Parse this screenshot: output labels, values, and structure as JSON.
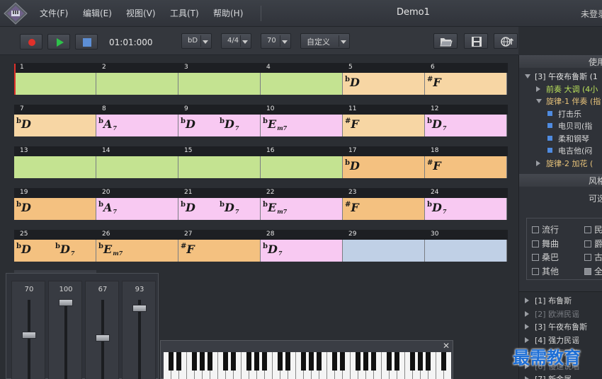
{
  "app": {
    "title": "Demo1",
    "login_text": "未登录",
    "menu": [
      "文件(F)",
      "编辑(E)",
      "视图(V)",
      "工具(T)",
      "帮助(H)"
    ]
  },
  "toolbar": {
    "time": "01:01:000",
    "key_label": "bD",
    "meter_label": "4/4",
    "tempo_label": "70",
    "style_label": "自定义"
  },
  "grid": {
    "rows": [
      [
        {
          "num": "1",
          "color": "#c4e391",
          "chords": []
        },
        {
          "num": "2",
          "color": "#c4e391",
          "chords": []
        },
        {
          "num": "3",
          "color": "#c4e391",
          "chords": []
        },
        {
          "num": "4",
          "color": "#c4e391",
          "chords": []
        },
        {
          "num": "5",
          "color": "#f7d6a4",
          "chords": [
            {
              "acc": "b",
              "root": "D",
              "suf": ""
            }
          ]
        },
        {
          "num": "6",
          "color": "#f7d6a4",
          "chords": [
            {
              "acc": "#",
              "root": "F",
              "suf": ""
            }
          ]
        }
      ],
      [
        {
          "num": "7",
          "color": "#f7d6a4",
          "chords": [
            {
              "acc": "b",
              "root": "D",
              "suf": ""
            }
          ]
        },
        {
          "num": "8",
          "color": "#f8c9f2",
          "chords": [
            {
              "acc": "b",
              "root": "A",
              "suf": "7"
            }
          ]
        },
        {
          "num": "9",
          "color": "#f8c9f2",
          "chords": [
            {
              "acc": "b",
              "root": "D",
              "suf": ""
            },
            {
              "acc": "b",
              "root": "D",
              "suf": "7"
            }
          ]
        },
        {
          "num": "10",
          "color": "#f8c9f2",
          "chords": [
            {
              "acc": "b",
              "root": "E",
              "suf": "m7"
            }
          ]
        },
        {
          "num": "11",
          "color": "#f7d6a4",
          "chords": [
            {
              "acc": "#",
              "root": "F",
              "suf": ""
            }
          ]
        },
        {
          "num": "12",
          "color": "#f8c9f2",
          "chords": [
            {
              "acc": "b",
              "root": "D",
              "suf": "7"
            }
          ]
        }
      ],
      [
        {
          "num": "13",
          "color": "#c4e391",
          "chords": []
        },
        {
          "num": "14",
          "color": "#c4e391",
          "chords": []
        },
        {
          "num": "15",
          "color": "#c4e391",
          "chords": []
        },
        {
          "num": "16",
          "color": "#c4e391",
          "chords": []
        },
        {
          "num": "17",
          "color": "#f4c180",
          "chords": [
            {
              "acc": "b",
              "root": "D",
              "suf": ""
            }
          ]
        },
        {
          "num": "18",
          "color": "#f4c180",
          "chords": [
            {
              "acc": "#",
              "root": "F",
              "suf": ""
            }
          ]
        }
      ],
      [
        {
          "num": "19",
          "color": "#f4c180",
          "chords": [
            {
              "acc": "b",
              "root": "D",
              "suf": ""
            }
          ]
        },
        {
          "num": "20",
          "color": "#f8c9f2",
          "chords": [
            {
              "acc": "b",
              "root": "A",
              "suf": "7"
            }
          ]
        },
        {
          "num": "21",
          "color": "#f8c9f2",
          "chords": [
            {
              "acc": "b",
              "root": "D",
              "suf": ""
            },
            {
              "acc": "b",
              "root": "D",
              "suf": "7"
            }
          ]
        },
        {
          "num": "22",
          "color": "#f8c9f2",
          "chords": [
            {
              "acc": "b",
              "root": "E",
              "suf": "m7"
            }
          ]
        },
        {
          "num": "23",
          "color": "#f4c180",
          "chords": [
            {
              "acc": "#",
              "root": "F",
              "suf": ""
            }
          ]
        },
        {
          "num": "24",
          "color": "#f8c9f2",
          "chords": [
            {
              "acc": "b",
              "root": "D",
              "suf": "7"
            }
          ]
        }
      ],
      [
        {
          "num": "25",
          "color": "#f4c180",
          "chords": [
            {
              "acc": "b",
              "root": "D",
              "suf": ""
            },
            {
              "acc": "b",
              "root": "D",
              "suf": "7"
            }
          ]
        },
        {
          "num": "26",
          "color": "#f4c180",
          "chords": [
            {
              "acc": "b",
              "root": "E",
              "suf": "m7"
            }
          ]
        },
        {
          "num": "27",
          "color": "#f4c180",
          "chords": [
            {
              "acc": "#",
              "root": "F",
              "suf": ""
            }
          ]
        },
        {
          "num": "28",
          "color": "#f8c9f2",
          "chords": [
            {
              "acc": "b",
              "root": "D",
              "suf": "7"
            }
          ]
        },
        {
          "num": "29",
          "color": "#c0d0e6",
          "chords": []
        },
        {
          "num": "30",
          "color": "#c0d0e6",
          "chords": []
        }
      ]
    ]
  },
  "mixer": {
    "channels": [
      {
        "value": "70",
        "level": 0.58
      },
      {
        "value": "100",
        "level": 0.97
      },
      {
        "value": "67",
        "level": 0.55
      },
      {
        "value": "93",
        "level": 0.9
      }
    ]
  },
  "right_panel": {
    "header1": "使用",
    "tree": [
      {
        "text": "[3] 午夜布鲁斯 (1",
        "kind": "open",
        "indent": 0,
        "color": "#e0e0e0"
      },
      {
        "text": "前奏 大调 (4小",
        "kind": "closed",
        "indent": 1,
        "color": "#b9e05a"
      },
      {
        "text": "旋律-1 伴奏 (指",
        "kind": "open",
        "indent": 1,
        "color": "#e8c37a"
      },
      {
        "text": "打击乐",
        "kind": "leaf",
        "indent": 2,
        "color": "#d6d6d6"
      },
      {
        "text": "电贝司(指",
        "kind": "leaf",
        "indent": 2,
        "color": "#d6d6d6"
      },
      {
        "text": "柔和钢琴",
        "kind": "leaf",
        "indent": 2,
        "color": "#d6d6d6"
      },
      {
        "text": "电吉他(闷",
        "kind": "leaf",
        "indent": 2,
        "color": "#d6d6d6"
      },
      {
        "text": "旋律-2 加花 (",
        "kind": "closed",
        "indent": 1,
        "color": "#e8c37a"
      }
    ],
    "header2": "风格",
    "subheader": "可选",
    "styles": [
      {
        "label": "流行",
        "checked": false
      },
      {
        "label": "民",
        "checked": false
      },
      {
        "label": "舞曲",
        "checked": false
      },
      {
        "label": "爵",
        "checked": false
      },
      {
        "label": "桑巴",
        "checked": false
      },
      {
        "label": "古",
        "checked": false
      },
      {
        "label": "其他",
        "checked": false
      },
      {
        "label": "全",
        "checked": true
      }
    ],
    "list": [
      {
        "text": "[1] 布鲁斯",
        "dim": false
      },
      {
        "text": "[2] 欧洲民谣",
        "dim": true
      },
      {
        "text": "[3] 午夜布鲁斯",
        "dim": false
      },
      {
        "text": "[4] 强力民谣",
        "dim": false
      },
      {
        "text": "[5] 流行乐曲",
        "dim": true
      },
      {
        "text": "[6] 慢速说唱",
        "dim": true
      },
      {
        "text": "[7] 新金属",
        "dim": false
      }
    ]
  },
  "watermark": "最需教育"
}
